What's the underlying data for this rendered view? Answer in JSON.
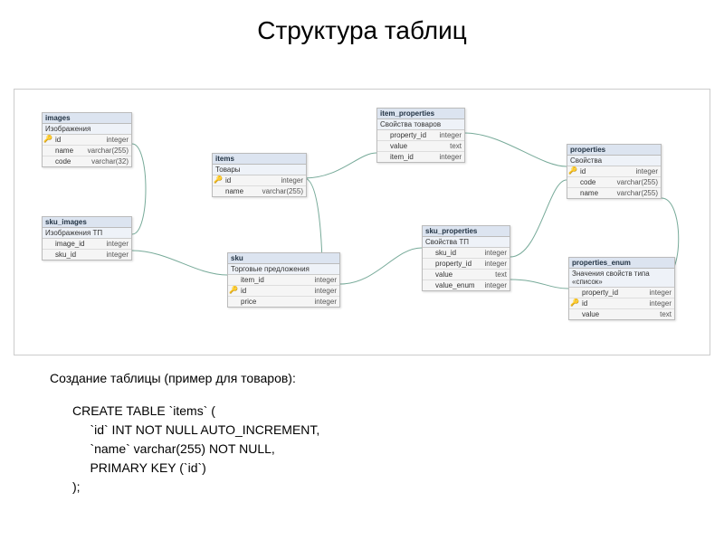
{
  "title": "Структура таблиц",
  "tables": {
    "images": {
      "name": "images",
      "subtitle": "Изображения",
      "columns": [
        {
          "key": true,
          "name": "id",
          "type": "integer"
        },
        {
          "key": false,
          "name": "name",
          "type": "varchar(255)"
        },
        {
          "key": false,
          "name": "code",
          "type": "varchar(32)"
        }
      ]
    },
    "sku_images": {
      "name": "sku_images",
      "subtitle": "Изображения ТП",
      "columns": [
        {
          "key": false,
          "name": "image_id",
          "type": "integer"
        },
        {
          "key": false,
          "name": "sku_id",
          "type": "integer"
        }
      ]
    },
    "items": {
      "name": "items",
      "subtitle": "Товары",
      "columns": [
        {
          "key": true,
          "name": "id",
          "type": "integer"
        },
        {
          "key": false,
          "name": "name",
          "type": "varchar(255)"
        }
      ]
    },
    "sku": {
      "name": "sku",
      "subtitle": "Торговые предложения",
      "columns": [
        {
          "key": false,
          "name": "item_id",
          "type": "integer"
        },
        {
          "key": true,
          "name": "id",
          "type": "integer"
        },
        {
          "key": false,
          "name": "price",
          "type": "integer"
        }
      ]
    },
    "item_properties": {
      "name": "item_properties",
      "subtitle": "Свойства товаров",
      "columns": [
        {
          "key": false,
          "name": "property_id",
          "type": "integer"
        },
        {
          "key": false,
          "name": "value",
          "type": "text"
        },
        {
          "key": false,
          "name": "item_id",
          "type": "integer"
        }
      ]
    },
    "sku_properties": {
      "name": "sku_properties",
      "subtitle": "Свойства ТП",
      "columns": [
        {
          "key": false,
          "name": "sku_id",
          "type": "integer"
        },
        {
          "key": false,
          "name": "property_id",
          "type": "integer"
        },
        {
          "key": false,
          "name": "value",
          "type": "text"
        },
        {
          "key": false,
          "name": "value_enum",
          "type": "integer"
        }
      ]
    },
    "properties": {
      "name": "properties",
      "subtitle": "Свойства",
      "columns": [
        {
          "key": true,
          "name": "id",
          "type": "integer"
        },
        {
          "key": false,
          "name": "code",
          "type": "varchar(255)"
        },
        {
          "key": false,
          "name": "name",
          "type": "varchar(255)"
        }
      ]
    },
    "properties_enum": {
      "name": "properties_enum",
      "subtitle": "Значения свойств типа «список»",
      "columns": [
        {
          "key": false,
          "name": "property_id",
          "type": "integer"
        },
        {
          "key": true,
          "name": "id",
          "type": "integer"
        },
        {
          "key": false,
          "name": "value",
          "type": "text"
        }
      ]
    }
  },
  "caption": "Создание таблицы (пример для товаров):",
  "sql": "CREATE TABLE `items` (\n     `id` INT NOT NULL AUTO_INCREMENT,\n     `name` varchar(255) NOT NULL,\n     PRIMARY KEY (`id`)\n);"
}
